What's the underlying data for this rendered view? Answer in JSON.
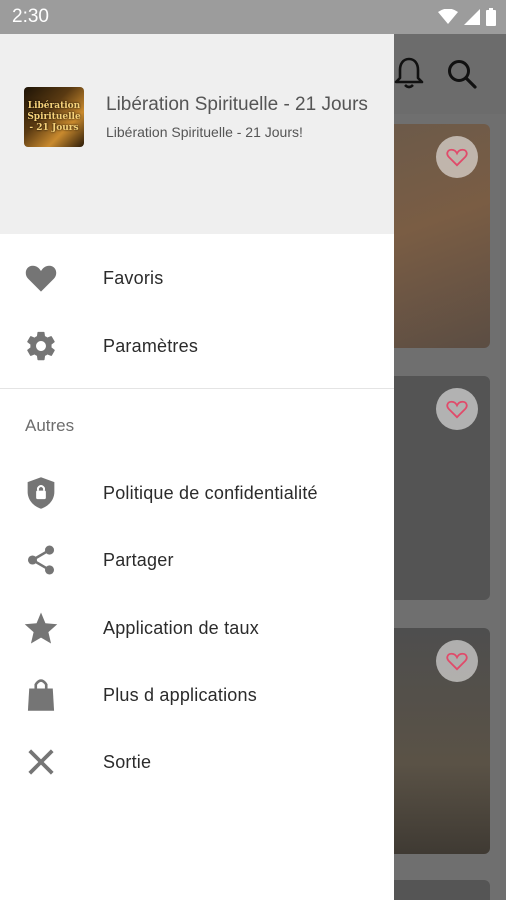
{
  "status_bar": {
    "time": "2:30",
    "icons": [
      "wifi-icon",
      "signal-icon",
      "battery-icon"
    ]
  },
  "background_app": {
    "toolbar_icons": [
      "bell-icon",
      "search-icon"
    ],
    "cards": [
      {
        "favorite_icon": "heart-outline-icon"
      },
      {
        "favorite_icon": "heart-outline-icon"
      },
      {
        "favorite_icon": "heart-outline-icon"
      }
    ]
  },
  "drawer": {
    "header": {
      "logo_text": [
        "Libération",
        "Spirituelle",
        "- 21 Jours"
      ],
      "title": "Libération Spirituelle - 21 Jours",
      "subtitle": "Libération Spirituelle - 21 Jours!"
    },
    "items": [
      {
        "label": "Favoris",
        "icon": "heart-icon"
      },
      {
        "label": "Paramètres",
        "icon": "gear-icon"
      }
    ],
    "section_title": "Autres",
    "other_items": [
      {
        "label": "Politique de confidentialité",
        "icon": "shield-lock-icon"
      },
      {
        "label": "Partager",
        "icon": "share-icon"
      },
      {
        "label": "Application de taux",
        "icon": "star-icon"
      },
      {
        "label": "Plus d applications",
        "icon": "shopping-bag-icon"
      },
      {
        "label": "Sortie",
        "icon": "close-icon"
      }
    ]
  },
  "colors": {
    "icon_gray": "#757575",
    "header_bg": "#efefef",
    "scrim": "#6f6f6f",
    "heart_accent": "#e04b6a"
  }
}
